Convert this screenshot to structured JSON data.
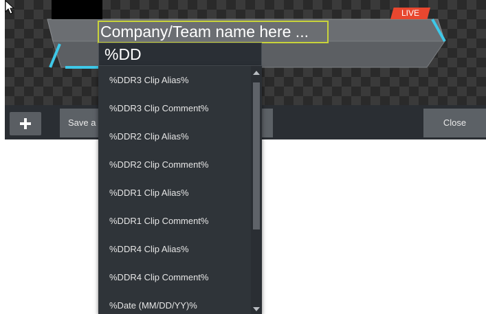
{
  "preview": {
    "live_label": "LIVE",
    "title_text": "Company/Team name here ...",
    "subtitle_text": "%DD"
  },
  "toolbar": {
    "add_icon": "plus-icon",
    "save_label": "Save a",
    "close_label": "Close"
  },
  "dropdown": {
    "items": [
      "%DDR3 Clip Alias%",
      "%DDR3 Clip Comment%",
      "%DDR2 Clip Alias%",
      "%DDR2 Clip Comment%",
      "%DDR1 Clip Alias%",
      "%DDR1 Clip Comment%",
      "%DDR4 Clip Alias%",
      "%DDR4 Clip Comment%",
      "%Date (MM/DD/YY)%"
    ],
    "scroll_position": 0.0
  },
  "colors": {
    "accent_cyan": "#3ec8e8",
    "live_red": "#e8472f",
    "edit_outline": "#c9d43a"
  }
}
